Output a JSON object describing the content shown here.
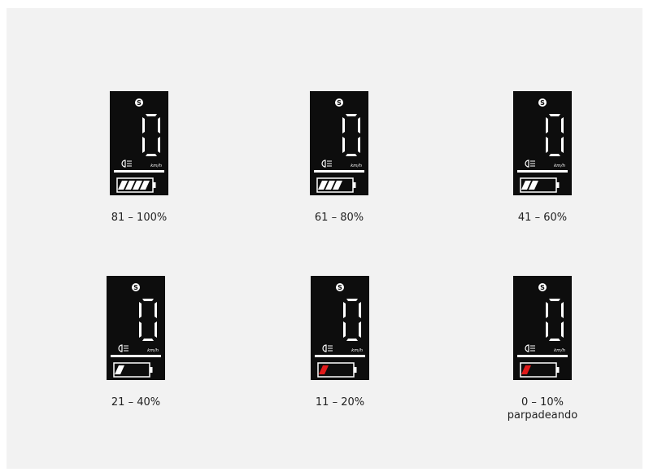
{
  "unit_label": "km/h",
  "speed_digit": "0",
  "mode_badge": "S",
  "colors": {
    "panel_background": "#f2f2f2",
    "display_background": "#0d0d0d",
    "segment_white": "#ffffff",
    "low_battery_red": "#e11a1a",
    "caption_text": "#222222"
  },
  "icons": [
    "mode-s-badge-icon",
    "headlight-icon",
    "battery-icon"
  ],
  "battery_levels": [
    {
      "label": "81 – 100%",
      "note": "",
      "bars": 4,
      "color": "white"
    },
    {
      "label": "61 – 80%",
      "note": "",
      "bars": 3,
      "color": "white"
    },
    {
      "label": "41 – 60%",
      "note": "",
      "bars": 2,
      "color": "white"
    },
    {
      "label": "21 – 40%",
      "note": "",
      "bars": 1,
      "color": "white"
    },
    {
      "label": "11 – 20%",
      "note": "",
      "bars": 1,
      "color": "red"
    },
    {
      "label": "0 – 10%",
      "note": "parpadeando",
      "bars": 1,
      "color": "red"
    }
  ]
}
